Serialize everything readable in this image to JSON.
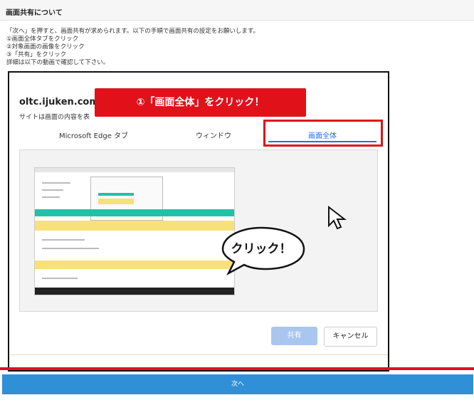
{
  "page_title": "画面共有について",
  "instructions": [
    "「次へ」を押すと、画面共有が求められます。以下の手順で画面共有の設定をお願いします。",
    "①画面全体タブをクリック",
    "②対象画面の画像をクリック",
    "③「共有」をクリック",
    "詳細は以下の動画で確認して下さい。"
  ],
  "dialog": {
    "site_prefix": "oltc.ijuken.com と",
    "subtitle_prefix": "サイトは画面の内容を表",
    "tabs": [
      "Microsoft Edge タブ",
      "ウィンドウ",
      "画面全体"
    ],
    "share_button": "共有",
    "cancel_button": "キャンセル"
  },
  "annotation_banner": "①「画面全体」をクリック！",
  "annotation_bubble": "クリック！",
  "next_button": "次へ",
  "colors": {
    "highlight_red": "#e1111a",
    "primary_blue": "#2f90d8",
    "tab_blue": "#1a73e8"
  }
}
